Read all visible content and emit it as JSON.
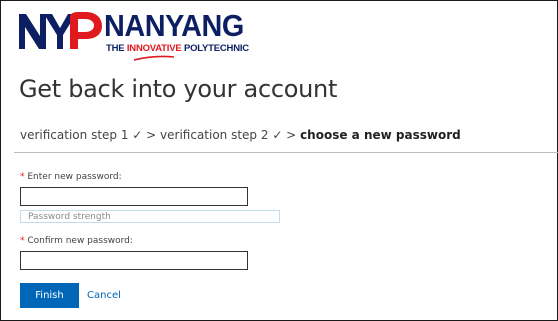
{
  "brand": {
    "logo_letters": "NYP",
    "name": "NANYANG",
    "tagline_prefix": "THE ",
    "tagline_highlight": "INNOVATIVE",
    "tagline_suffix": " POLYTECHNIC",
    "colors": {
      "navy": "#0d1f63",
      "red": "#e0191f"
    }
  },
  "page": {
    "title": "Get back into your account"
  },
  "breadcrumb": {
    "step1": "verification step 1 ✓ > ",
    "step2": "verification step 2 ✓ > ",
    "current": "choose a new password"
  },
  "form": {
    "new_password": {
      "required_mark": "* ",
      "label": "Enter new password:",
      "value": ""
    },
    "strength": {
      "label": "Password strength"
    },
    "confirm_password": {
      "required_mark": "* ",
      "label": "Confirm new password:",
      "value": ""
    },
    "finish_label": "Finish",
    "cancel_label": "Cancel"
  },
  "colors": {
    "accent": "#0067b8",
    "required": "#e81123",
    "strength_border": "#c3dbea"
  }
}
